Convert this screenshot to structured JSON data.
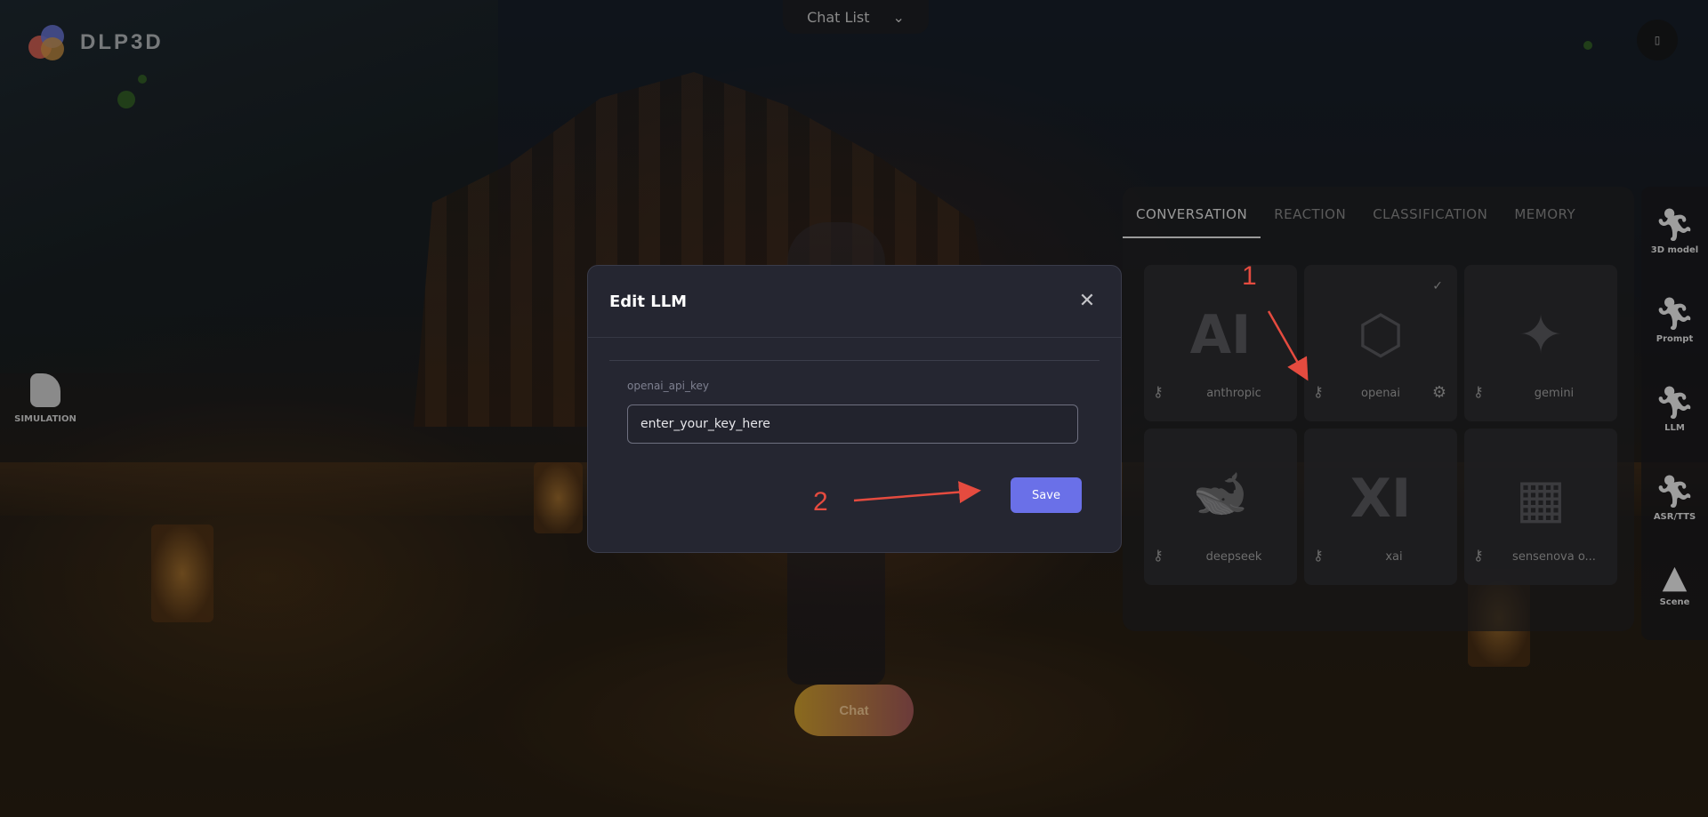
{
  "app": {
    "logo_text": "DLP3D"
  },
  "top": {
    "chat_list_label": "Chat List",
    "chat_list_chevron": "⌄",
    "top_right_glyph": "▯"
  },
  "left": {
    "simulation_label": "SIMULATION"
  },
  "panel": {
    "tabs": [
      "CONVERSATION",
      "REACTION",
      "CLASSIFICATION",
      "MEMORY"
    ],
    "active_tab": "CONVERSATION",
    "cards": [
      {
        "name": "anthropic",
        "logo": "AI",
        "selected": false,
        "settings": false
      },
      {
        "name": "openai",
        "logo": "⬡",
        "selected": true,
        "settings": true
      },
      {
        "name": "gemini",
        "logo": "✦",
        "selected": false,
        "settings": false
      },
      {
        "name": "deepseek",
        "logo": "🐋",
        "selected": false,
        "settings": false
      },
      {
        "name": "xai",
        "logo": "XI",
        "selected": false,
        "settings": false
      },
      {
        "name": "sensenova o...",
        "logo": "▦",
        "selected": false,
        "settings": false
      }
    ],
    "key_icon": "⚷",
    "check_icon": "✓",
    "gear_icon": "⚙"
  },
  "sidebar": {
    "items": [
      {
        "label": "3D model",
        "icon": "running-figure-sparkle-icon"
      },
      {
        "label": "Prompt",
        "icon": "figure-speech-icon"
      },
      {
        "label": "LLM",
        "icon": "figure-sparkle-icon"
      },
      {
        "label": "ASR/TTS",
        "icon": "figure-music-icon"
      },
      {
        "label": "Scene",
        "icon": "tree-icon"
      }
    ]
  },
  "chat_button_label": "Chat",
  "modal": {
    "title": "Edit LLM",
    "close_glyph": "✕",
    "field_label": "openai_api_key",
    "field_value": "enter_your_key_here",
    "save_label": "Save"
  },
  "annotations": {
    "num1": "1",
    "num2": "2",
    "color": "#e54b3f"
  },
  "colors": {
    "accent": "#6a70e8",
    "modal_bg": "#252631"
  }
}
